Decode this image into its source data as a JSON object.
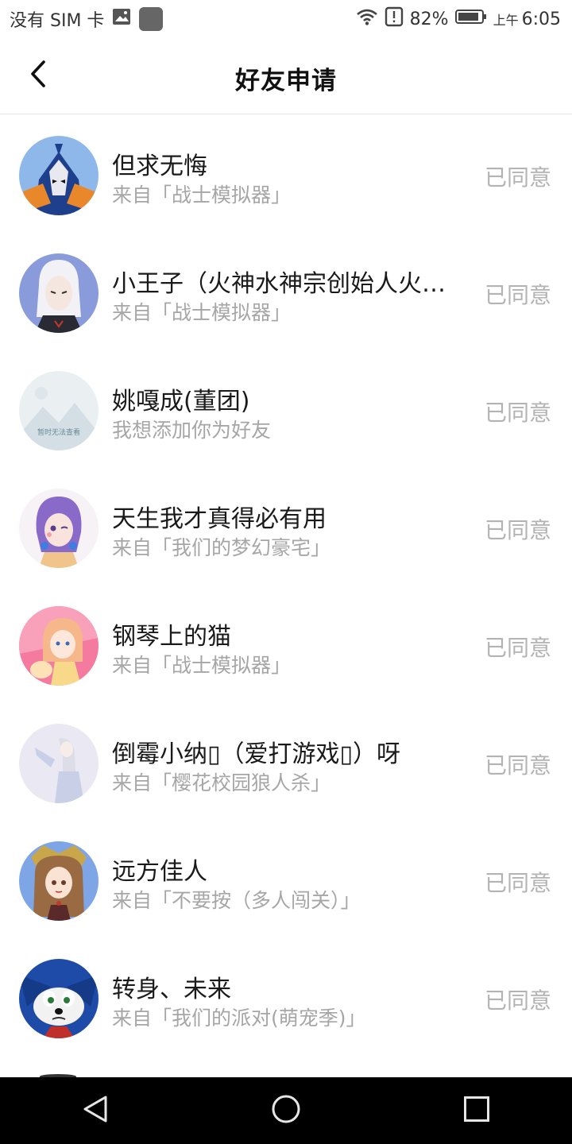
{
  "status_bar": {
    "carrier": "没有 SIM 卡",
    "battery": "82%",
    "ampm": "上午",
    "time": "6:05"
  },
  "header": {
    "title": "好友申请"
  },
  "requests": [
    {
      "name": "但求无悔",
      "source": "来自「战士模拟器」",
      "status": "已同意"
    },
    {
      "name": "小王子（火神水神宗创始人火神…",
      "source": "来自「战士模拟器」",
      "status": "已同意"
    },
    {
      "name": "姚嘎成(董团)",
      "source": "我想添加你为好友",
      "status": "已同意",
      "avatar_placeholder_text": "暂时无法查看"
    },
    {
      "name": "天生我才真得必有用",
      "source": "来自「我们的梦幻豪宅」",
      "status": "已同意"
    },
    {
      "name": "钢琴上的猫",
      "source": "来自「战士模拟器」",
      "status": "已同意"
    },
    {
      "name": "倒霉小纳▯（爱打游戏▯）呀",
      "source": "来自「樱花校园狼人杀」",
      "status": "已同意"
    },
    {
      "name": "远方佳人",
      "source": "来自「不要按（多人闯关）」",
      "status": "已同意"
    },
    {
      "name": "转身、未来",
      "source": "来自「我们的派对(萌宠季)」",
      "status": "已同意"
    }
  ],
  "icons": {
    "back": "chevron-left-icon",
    "nav_back": "triangle-back-icon",
    "nav_home": "circle-home-icon",
    "nav_recents": "square-recents-icon"
  },
  "colors": {
    "status_text": "#b3b3b3",
    "source_text": "#a6a6a6",
    "nav_bg": "#000000"
  }
}
